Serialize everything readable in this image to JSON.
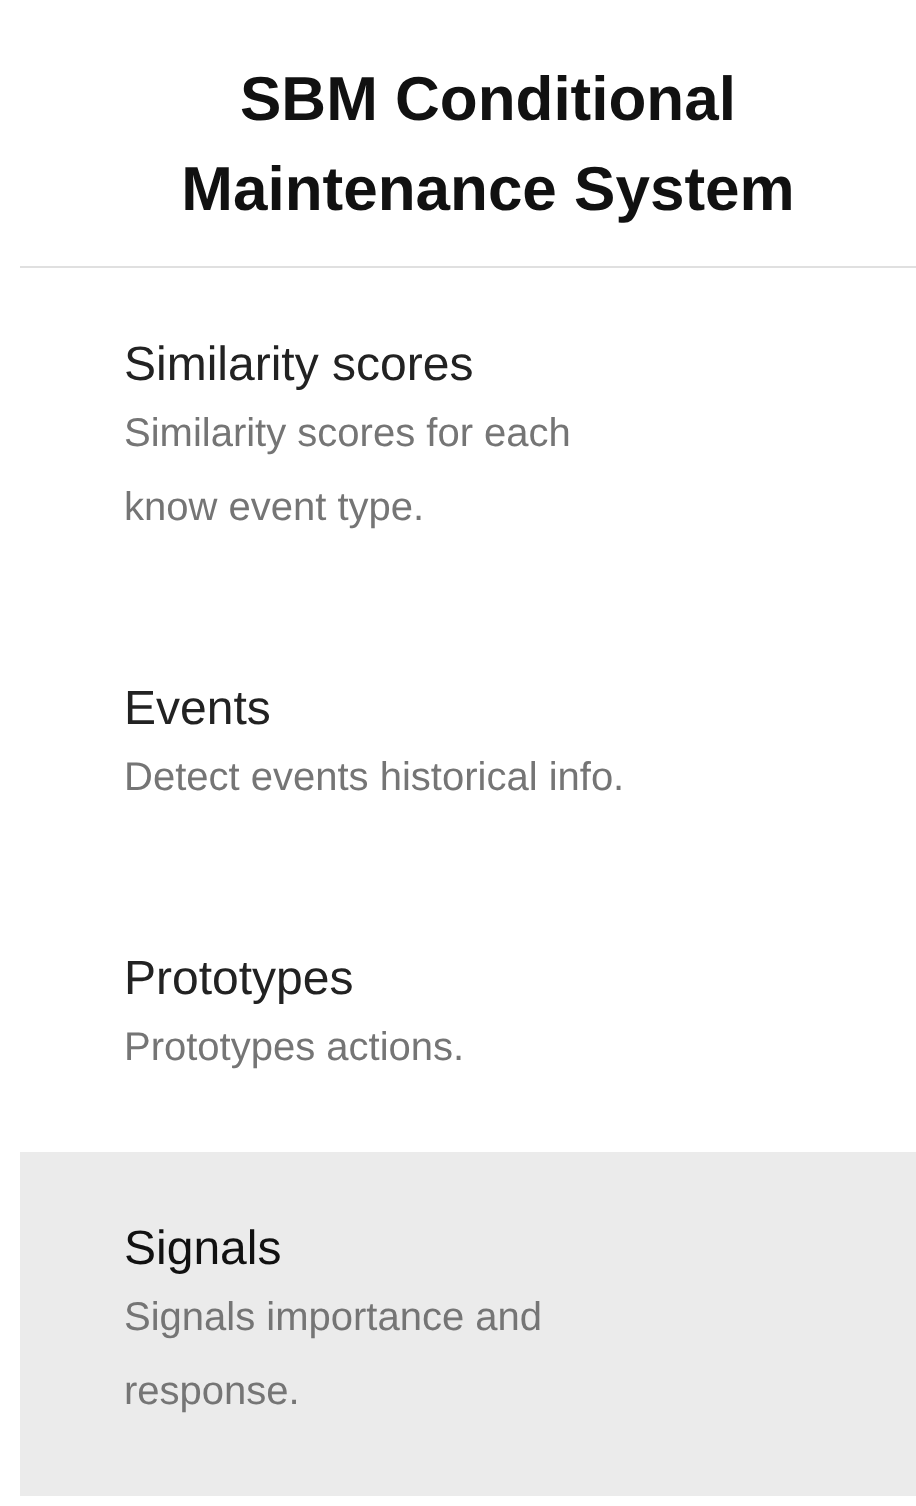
{
  "header": {
    "title": "SBM Conditional Maintenance System"
  },
  "nav_items": [
    {
      "title": "Similarity scores",
      "description": "Similarity scores for each\nknow event type.",
      "selected": false
    },
    {
      "title": "Events",
      "description": "Detect events historical info.",
      "selected": false
    },
    {
      "title": "Prototypes",
      "description": "Prototypes actions.",
      "selected": false
    },
    {
      "title": "Signals",
      "description": "Signals importance and\nresponse.",
      "selected": true
    }
  ]
}
